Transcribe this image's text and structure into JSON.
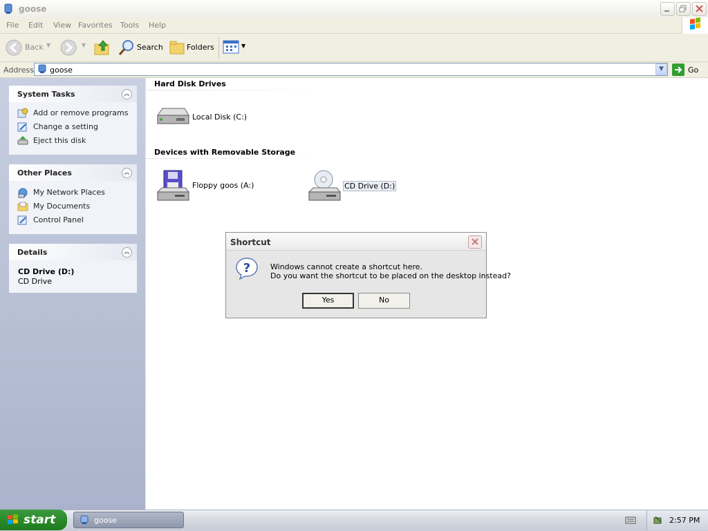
{
  "window": {
    "title": "goose",
    "menu": [
      "File",
      "Edit",
      "View",
      "Favorites",
      "Tools",
      "Help"
    ]
  },
  "toolbar": {
    "back_label": "Back",
    "search_label": "Search",
    "folders_label": "Folders"
  },
  "address": {
    "label": "Address",
    "value": "goose",
    "go_label": "Go"
  },
  "sidebar": {
    "system_tasks": {
      "title": "System Tasks",
      "items": [
        "Add or remove programs",
        "Change a setting",
        "Eject this disk"
      ]
    },
    "other_places": {
      "title": "Other Places",
      "items": [
        "My Network Places",
        "My Documents",
        "Control Panel"
      ]
    },
    "details": {
      "title": "Details",
      "name": "CD Drive (D:)",
      "type": "CD Drive"
    }
  },
  "content": {
    "hard_disk_header": "Hard Disk Drives",
    "local_disk": "Local Disk (C:)",
    "removable_header": "Devices with Removable Storage",
    "floppy": "Floppy goos (A:)",
    "cd_drive": "CD Drive (D:)"
  },
  "dialog": {
    "title": "Shortcut",
    "message_line1": "Windows cannot create a shortcut here.",
    "message_line2": "Do you want the shortcut to be placed on the desktop instead?",
    "yes_label": "Yes",
    "no_label": "No"
  },
  "taskbar": {
    "start_label": "start",
    "task_label": "goose",
    "clock": "2:57 PM"
  },
  "colors": {
    "accent": "#316ac5",
    "start_green": "#2b8a2b",
    "go_green": "#2f9e2f"
  }
}
